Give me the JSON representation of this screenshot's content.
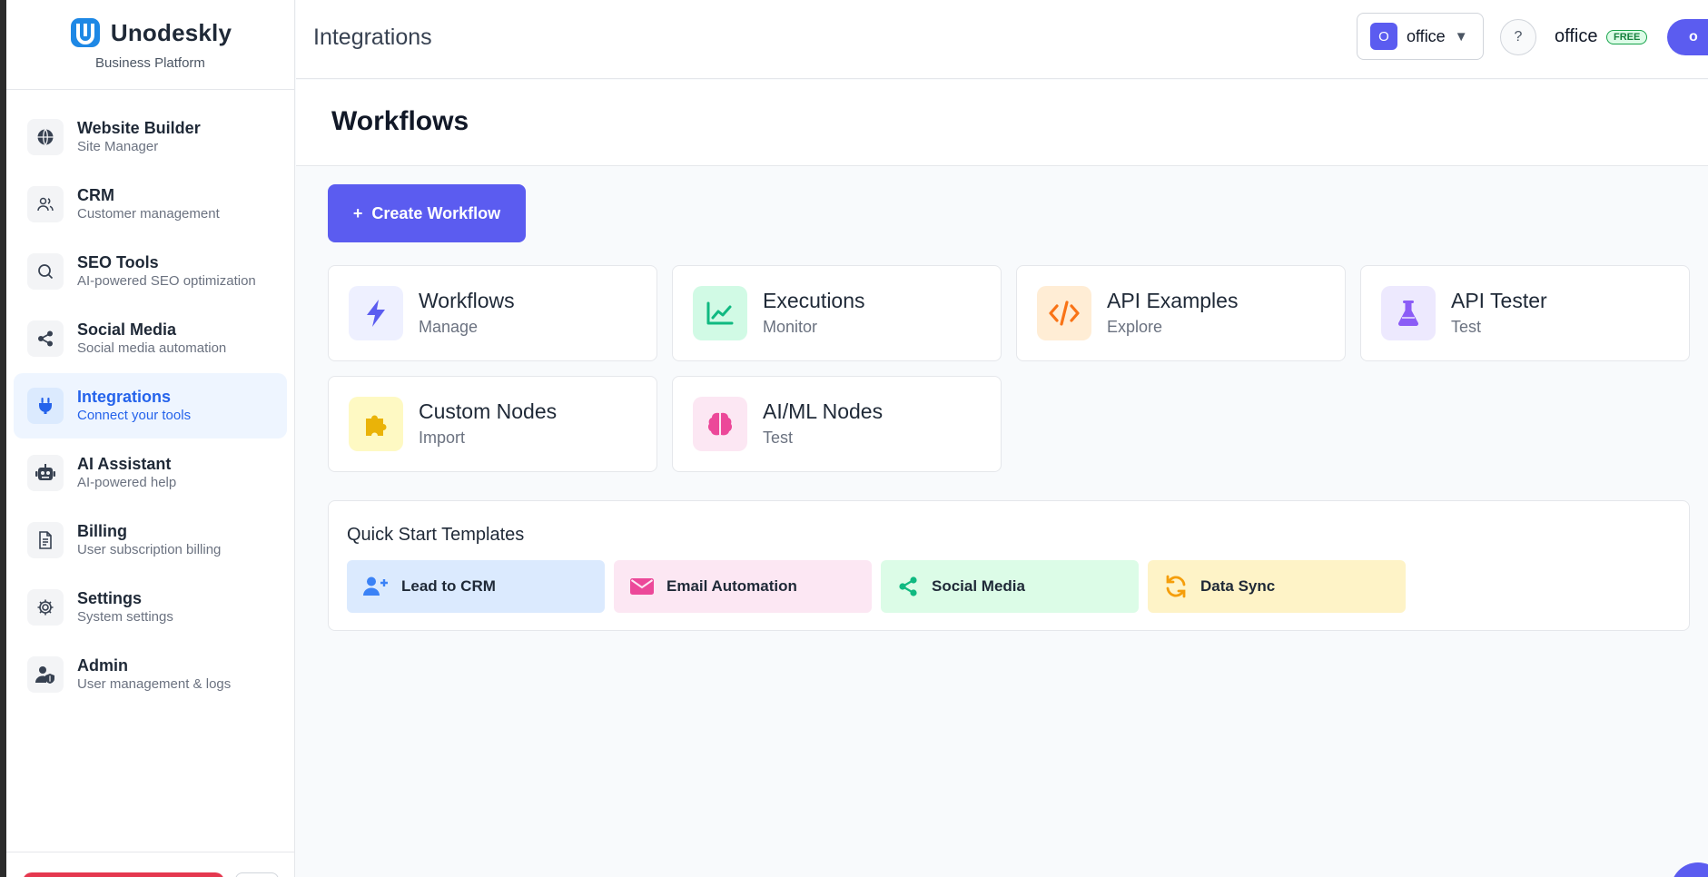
{
  "brand": {
    "name": "Unodeskly",
    "subtitle": "Business Platform"
  },
  "sidebar": {
    "items": [
      {
        "title": "Website Builder",
        "subtitle": "Site Manager",
        "icon": "globe-icon",
        "active": false
      },
      {
        "title": "CRM",
        "subtitle": "Customer management",
        "icon": "users-icon",
        "active": false
      },
      {
        "title": "SEO Tools",
        "subtitle": "AI-powered SEO optimization",
        "icon": "search-icon",
        "active": false
      },
      {
        "title": "Social Media",
        "subtitle": "Social media automation",
        "icon": "share-icon",
        "active": false
      },
      {
        "title": "Integrations",
        "subtitle": "Connect your tools",
        "icon": "plug-icon",
        "active": true
      },
      {
        "title": "AI Assistant",
        "subtitle": "AI-powered help",
        "icon": "robot-icon",
        "active": false
      },
      {
        "title": "Billing",
        "subtitle": "User subscription billing",
        "icon": "document-icon",
        "active": false
      },
      {
        "title": "Settings",
        "subtitle": "System settings",
        "icon": "gear-icon",
        "active": false
      },
      {
        "title": "Admin",
        "subtitle": "User management & logs",
        "icon": "user-shield-icon",
        "active": false
      }
    ]
  },
  "topbar": {
    "title": "Integrations",
    "org": {
      "badge": "O",
      "name": "office",
      "caret": "▼"
    },
    "help": "?",
    "user": {
      "name": "office",
      "plan": "FREE",
      "avatar": "o"
    }
  },
  "page": {
    "title": "Workflows"
  },
  "create_button": {
    "plus": "+",
    "label": "Create Workflow"
  },
  "tiles": [
    {
      "title": "Workflows",
      "subtitle": "Manage",
      "icon": "lightning-icon",
      "color": "#5b5cf0",
      "bg": "#eef0ff"
    },
    {
      "title": "Executions",
      "subtitle": "Monitor",
      "icon": "chart-line-icon",
      "color": "#10b981",
      "bg": "#d1fae5"
    },
    {
      "title": "API Examples",
      "subtitle": "Explore",
      "icon": "code-icon",
      "color": "#f97316",
      "bg": "#ffedd5"
    },
    {
      "title": "API Tester",
      "subtitle": "Test",
      "icon": "flask-icon",
      "color": "#8b5cf6",
      "bg": "#ede9fe"
    },
    {
      "title": "Custom Nodes",
      "subtitle": "Import",
      "icon": "puzzle-icon",
      "color": "#eab308",
      "bg": "#fef9c3"
    },
    {
      "title": "AI/ML Nodes",
      "subtitle": "Test",
      "icon": "brain-icon",
      "color": "#ec4899",
      "bg": "#fce7f3"
    }
  ],
  "quick_start": {
    "title": "Quick Start Templates",
    "items": [
      {
        "label": "Lead to CRM",
        "icon": "user-plus-icon",
        "color": "#3b82f6",
        "bg": "#dbeafe"
      },
      {
        "label": "Email Automation",
        "icon": "envelope-icon",
        "color": "#ec4899",
        "bg": "#fce7f3"
      },
      {
        "label": "Social Media",
        "icon": "share-icon",
        "color": "#10b981",
        "bg": "#dcfce7"
      },
      {
        "label": "Data Sync",
        "icon": "sync-icon",
        "color": "#f59e0b",
        "bg": "#fef3c7"
      }
    ]
  },
  "colors": {
    "primary": "#5b5cf0",
    "active_nav": "#2563eb",
    "active_nav_bg": "#eef5ff"
  }
}
